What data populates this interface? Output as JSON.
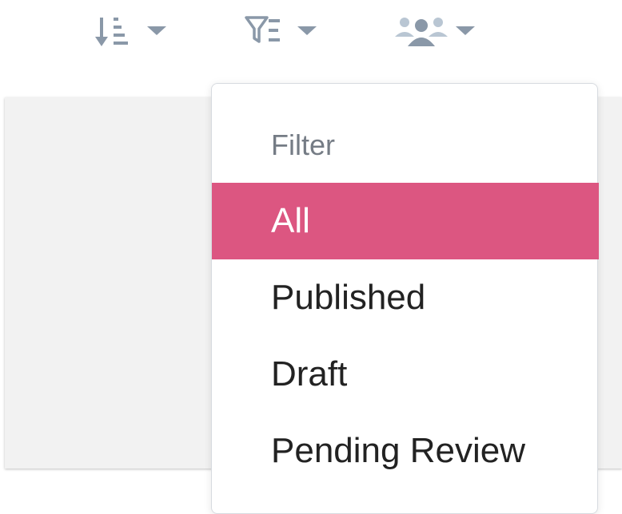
{
  "toolbar": {
    "sort_icon": "sort-descending-icon",
    "filter_icon": "filter-list-icon",
    "users_icon": "users-group-icon",
    "caret_icon": "caret-down-icon"
  },
  "filter_menu": {
    "header": "Filter",
    "items": [
      {
        "label": "All",
        "active": true
      },
      {
        "label": "Published",
        "active": false
      },
      {
        "label": "Draft",
        "active": false
      },
      {
        "label": "Pending Review",
        "active": false
      }
    ]
  },
  "colors": {
    "accent": "#dc5681",
    "icon": "#8a98a8",
    "panel_bg": "#f2f2f2",
    "header_text": "#757c85",
    "item_text": "#222222"
  }
}
